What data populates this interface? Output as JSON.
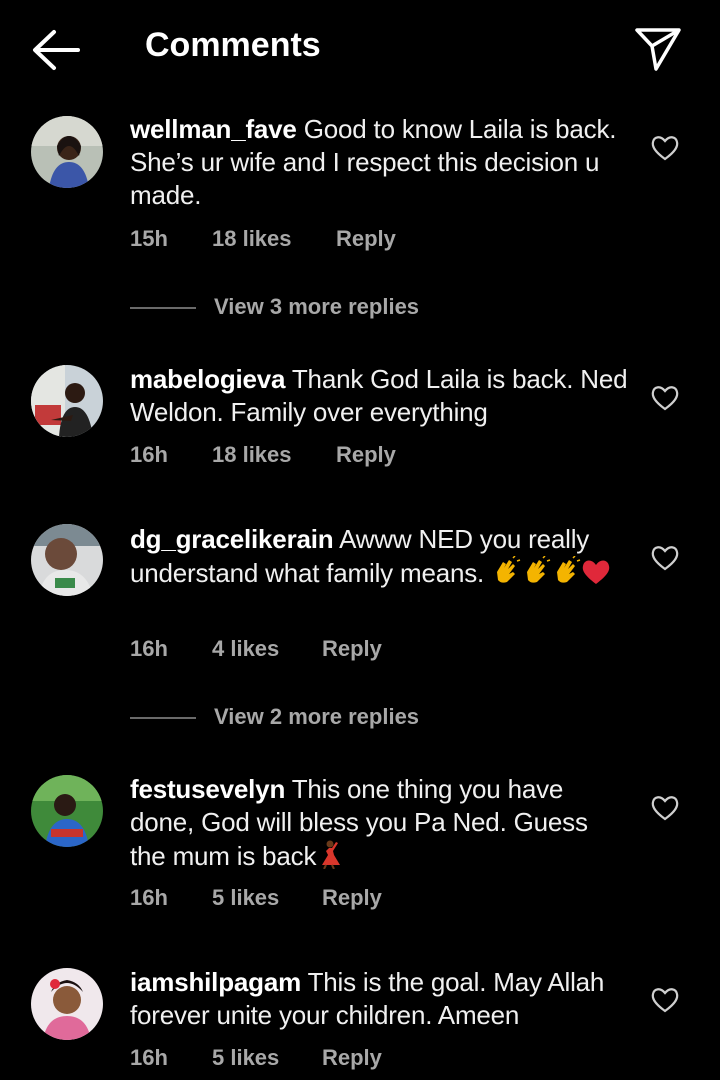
{
  "header": {
    "title": "Comments",
    "back_icon": "arrow-left-icon",
    "share_icon": "paper-plane-icon"
  },
  "actions": {
    "reply_label": "Reply"
  },
  "comments": [
    {
      "username": "wellman_fave",
      "text": "Good to know Laila is back.  She’s ur wife and I respect this decision u made.",
      "time": "15h",
      "likes": "18 likes",
      "view_replies": "View 3 more replies"
    },
    {
      "username": "mabelogieva",
      "text": "Thank God Laila is back. Ned Weldon. Family over everything",
      "time": "16h",
      "likes": "18 likes"
    },
    {
      "username": "dg_gracelikerain",
      "text": "Awww NED you really understand what family means.",
      "emojis": [
        "clapping-hands",
        "clapping-hands",
        "clapping-hands",
        "red-heart"
      ],
      "time": "16h",
      "likes": "4 likes",
      "view_replies": "View 2 more replies"
    },
    {
      "username": "festusevelyn",
      "text": "This one thing you have done, God will bless you Pa Ned. Guess the mum is back",
      "emojis": [
        "woman-dancing"
      ],
      "time": "16h",
      "likes": "5 likes"
    },
    {
      "username": "iamshilpagam",
      "text": "This is the goal. May Allah forever unite your children. Ameen",
      "time": "16h",
      "likes": "5 likes"
    }
  ],
  "colors": {
    "background": "#000000",
    "text": "#f0f0f0",
    "muted": "#a8a8a8"
  }
}
